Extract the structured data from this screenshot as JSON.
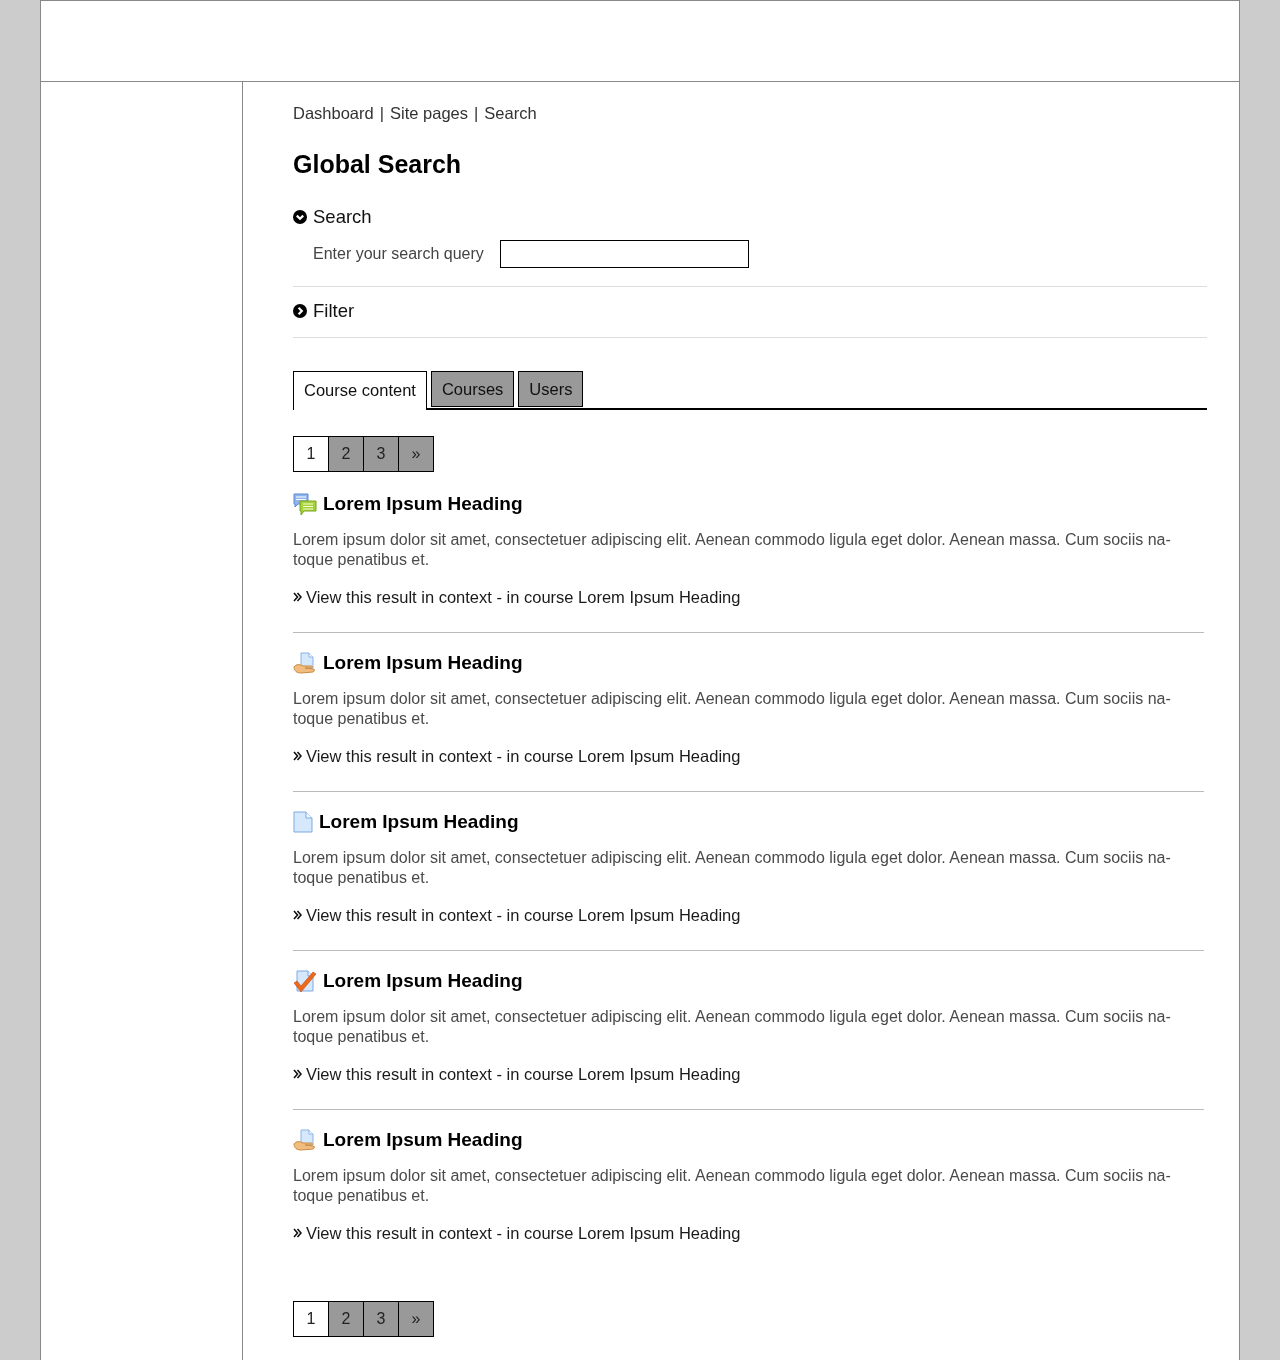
{
  "breadcrumb": {
    "items": [
      {
        "label": "Dashboard"
      },
      {
        "label": "Site pages"
      },
      {
        "label": "Search"
      }
    ],
    "separators": [
      "|",
      "|"
    ]
  },
  "page_title": "Global Search",
  "sections": [
    {
      "title": "Search",
      "expanded": true,
      "fields": [
        {
          "label": "Enter your search query"
        }
      ]
    },
    {
      "title": "Filter",
      "expanded": false
    }
  ],
  "tabs": [
    {
      "label": "Course content",
      "selected": true
    },
    {
      "label": "Courses",
      "selected": false
    },
    {
      "label": "Users",
      "selected": false
    }
  ],
  "pager_top": [
    {
      "label": "1",
      "selected": true
    },
    {
      "label": "2",
      "selected": false
    },
    {
      "label": "3",
      "selected": false
    },
    {
      "label": "»",
      "selected": false
    }
  ],
  "results": [
    {
      "kind": "forum",
      "heading": "Lorem Ipsum Heading",
      "snippet": "Lorem ipsum dolor sit amet, consectetuer adipiscing elit. Aenean commodo ligula eget dolor. Aenean massa. Cum sociis na-\ntoque penatibus et.",
      "context_link": "View this result in context - in course Lorem Ipsum Heading"
    },
    {
      "kind": "resource",
      "heading": "Lorem Ipsum Heading",
      "snippet": "Lorem ipsum dolor sit amet, consectetuer adipiscing elit. Aenean commodo ligula eget dolor. Aenean massa. Cum sociis na-\ntoque penatibus et.",
      "context_link": "View this result in context - in course Lorem Ipsum Heading"
    },
    {
      "kind": "page",
      "heading": "Lorem Ipsum Heading",
      "snippet": "Lorem ipsum dolor sit amet, consectetuer adipiscing elit. Aenean commodo ligula eget dolor. Aenean massa. Cum sociis na-\ntoque penatibus et.",
      "context_link": "View this result in context - in course Lorem Ipsum Heading"
    },
    {
      "kind": "assignment",
      "heading": "Lorem Ipsum Heading",
      "snippet": "Lorem ipsum dolor sit amet, consectetuer adipiscing elit. Aenean commodo ligula eget dolor. Aenean massa. Cum sociis na-\ntoque penatibus et.",
      "context_link": "View this result in context - in course Lorem Ipsum Heading"
    },
    {
      "kind": "resource",
      "heading": "Lorem Ipsum Heading",
      "snippet": "Lorem ipsum dolor sit amet, consectetuer adipiscing elit. Aenean commodo ligula eget dolor. Aenean massa. Cum sociis na-\ntoque penatibus et.",
      "context_link": "View this result in context - in course Lorem Ipsum Heading"
    }
  ],
  "pager_bottom": [
    {
      "label": "1",
      "selected": true
    },
    {
      "label": "2",
      "selected": false
    },
    {
      "label": "3",
      "selected": false
    },
    {
      "label": "»",
      "selected": false
    }
  ]
}
